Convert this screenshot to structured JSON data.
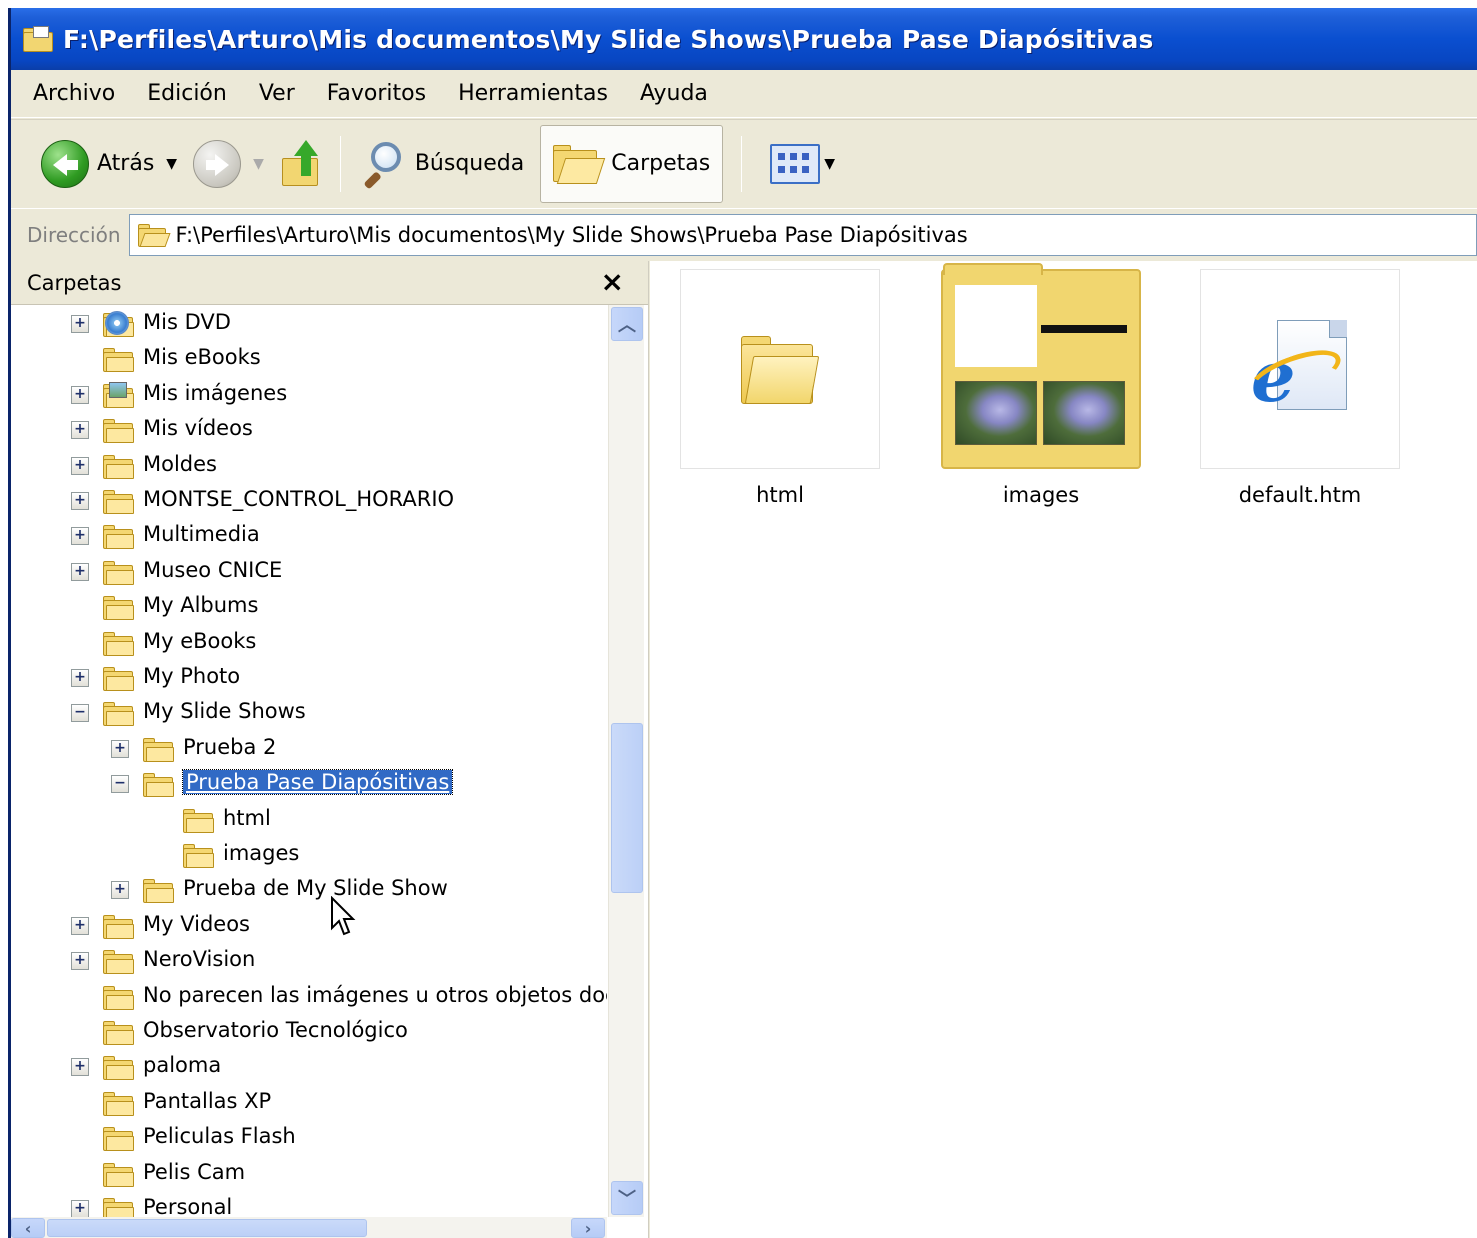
{
  "window": {
    "title": "F:\\Perfiles\\Arturo\\Mis documentos\\My Slide Shows\\Prueba  Pase Diapósitivas"
  },
  "menu": [
    "Archivo",
    "Edición",
    "Ver",
    "Favoritos",
    "Herramientas",
    "Ayuda"
  ],
  "toolbar": {
    "back_label": "Atrás",
    "search_label": "Búsqueda",
    "folders_label": "Carpetas"
  },
  "address": {
    "label": "Dirección",
    "path": "F:\\Perfiles\\Arturo\\Mis documentos\\My Slide Shows\\Prueba  Pase Diapósitivas"
  },
  "folder_pane": {
    "title": "Carpetas",
    "close": "×",
    "items": [
      {
        "label": "Mis DVD",
        "level": 0,
        "expander": "+",
        "icon": "dvd-folder-icon"
      },
      {
        "label": "Mis eBooks",
        "level": 0,
        "expander": "",
        "icon": "folder-icon"
      },
      {
        "label": "Mis imágenes",
        "level": 0,
        "expander": "+",
        "icon": "pictures-folder-icon"
      },
      {
        "label": "Mis vídeos",
        "level": 0,
        "expander": "+",
        "icon": "folder-icon"
      },
      {
        "label": "Moldes",
        "level": 0,
        "expander": "+",
        "icon": "folder-icon"
      },
      {
        "label": "MONTSE_CONTROL_HORARIO",
        "level": 0,
        "expander": "+",
        "icon": "folder-icon"
      },
      {
        "label": "Multimedia",
        "level": 0,
        "expander": "+",
        "icon": "folder-icon"
      },
      {
        "label": "Museo CNICE",
        "level": 0,
        "expander": "+",
        "icon": "folder-icon"
      },
      {
        "label": "My Albums",
        "level": 0,
        "expander": "",
        "icon": "folder-icon"
      },
      {
        "label": "My eBooks",
        "level": 0,
        "expander": "",
        "icon": "folder-icon"
      },
      {
        "label": "My Photo",
        "level": 0,
        "expander": "+",
        "icon": "folder-icon"
      },
      {
        "label": "My Slide Shows",
        "level": 0,
        "expander": "−",
        "icon": "folder-icon"
      },
      {
        "label": "Prueba 2",
        "level": 1,
        "expander": "+",
        "icon": "folder-icon"
      },
      {
        "label": "Prueba  Pase Diapósitivas",
        "level": 1,
        "expander": "−",
        "icon": "folder-icon",
        "selected": true
      },
      {
        "label": "html",
        "level": 2,
        "expander": "",
        "icon": "folder-icon"
      },
      {
        "label": "images",
        "level": 2,
        "expander": "",
        "icon": "folder-icon"
      },
      {
        "label": "Prueba de My Slide Show",
        "level": 1,
        "expander": "+",
        "icon": "folder-icon"
      },
      {
        "label": "My Videos",
        "level": 0,
        "expander": "+",
        "icon": "folder-icon"
      },
      {
        "label": "NeroVision",
        "level": 0,
        "expander": "+",
        "icon": "folder-icon"
      },
      {
        "label": "No parecen las imágenes u otros objetos docu",
        "level": 0,
        "expander": "",
        "icon": "folder-icon"
      },
      {
        "label": "Observatorio Tecnológico",
        "level": 0,
        "expander": "",
        "icon": "folder-icon"
      },
      {
        "label": "paloma",
        "level": 0,
        "expander": "+",
        "icon": "folder-icon"
      },
      {
        "label": "Pantallas XP",
        "level": 0,
        "expander": "",
        "icon": "folder-icon"
      },
      {
        "label": "Peliculas Flash",
        "level": 0,
        "expander": "",
        "icon": "folder-icon"
      },
      {
        "label": "Pelis Cam",
        "level": 0,
        "expander": "",
        "icon": "folder-icon"
      },
      {
        "label": "Personal",
        "level": 0,
        "expander": "+",
        "icon": "folder-icon"
      }
    ]
  },
  "files": [
    {
      "name": "html",
      "icon": "folder-icon"
    },
    {
      "name": "images",
      "icon": "image-folder-thumbnail"
    },
    {
      "name": "default.htm",
      "icon": "ie-document-icon"
    }
  ]
}
